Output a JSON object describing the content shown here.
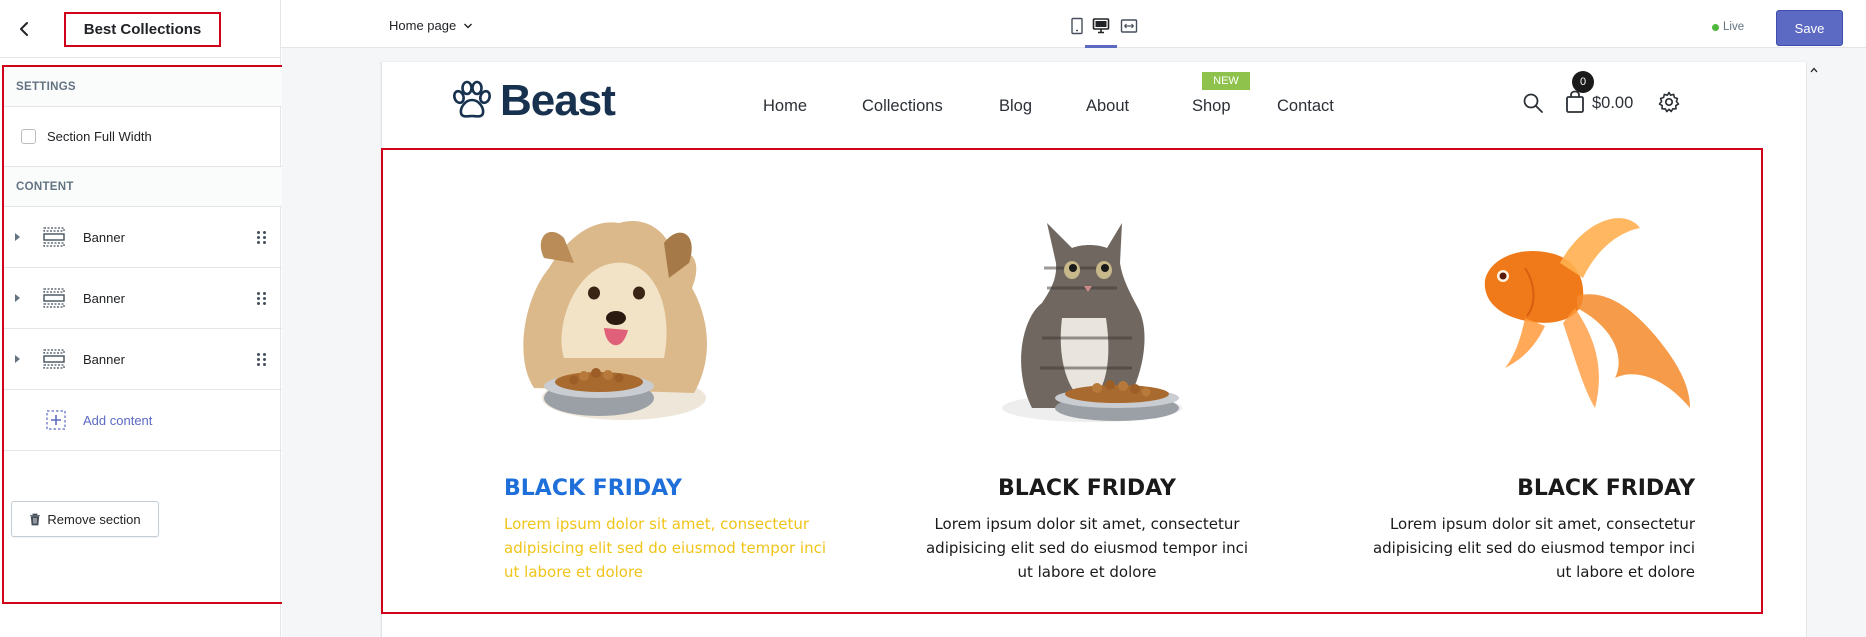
{
  "sidebar": {
    "title": "Best Collections",
    "settings_heading": "SETTINGS",
    "full_width_label": "Section Full Width",
    "content_heading": "CONTENT",
    "blocks": [
      {
        "label": "Banner"
      },
      {
        "label": "Banner"
      },
      {
        "label": "Banner"
      }
    ],
    "add_content_label": "Add content",
    "remove_section_label": "Remove section"
  },
  "toolbar": {
    "page_select": "Home page",
    "live_label": "Live",
    "save_label": "Save"
  },
  "store": {
    "logo_text": "Beast",
    "nav": [
      "Home",
      "Collections",
      "Blog",
      "About",
      "Shop",
      "Contact"
    ],
    "new_badge": "NEW",
    "cart_count": "0",
    "cart_total": "$0.00"
  },
  "section": {
    "cards": [
      {
        "title": "BLACK FRIDAY",
        "text": "Lorem ipsum dolor sit amet, consectetur adipisicing elit sed do eiusmod tempor inci ut labore et dolore",
        "align": "left",
        "title_color": "#1e6fd9",
        "text_color": "#f0c419",
        "animal": "dog"
      },
      {
        "title": "BLACK FRIDAY",
        "text": "Lorem ipsum dolor sit amet, consectetur adipisicing elit sed do eiusmod tempor inci ut labore et dolore",
        "align": "center",
        "title_color": "#1a1a1a",
        "text_color": "#1a1a1a",
        "animal": "kitten"
      },
      {
        "title": "BLACK FRIDAY",
        "text": "Lorem ipsum dolor sit amet, consectetur adipisicing elit sed do eiusmod tempor inci ut labore et dolore",
        "align": "right",
        "title_color": "#1a1a1a",
        "text_color": "#1a1a1a",
        "animal": "goldfish"
      }
    ]
  },
  "colors": {
    "accent": "#5c6ac4",
    "highlight": "#d0021b",
    "badge": "#8fc24d"
  }
}
